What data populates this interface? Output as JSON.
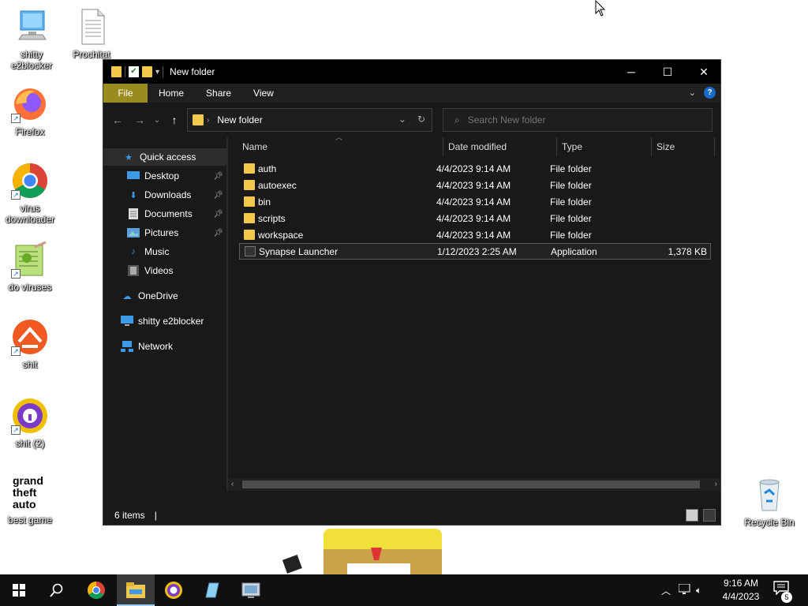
{
  "desktop": {
    "icons": [
      {
        "label": "shitty e2blocker",
        "icon": "computer-icon"
      },
      {
        "label": "Prochitat",
        "icon": "document-icon"
      },
      {
        "label": "Firefox",
        "icon": "firefox-icon"
      },
      {
        "label": "virus downloader",
        "icon": "chrome-icon"
      },
      {
        "label": "do viruses",
        "icon": "notepadpp-icon"
      },
      {
        "label": "shit",
        "icon": "sparkle-icon"
      },
      {
        "label": "shit (2)",
        "icon": "brave-icon"
      },
      {
        "label": "best game",
        "icon": "gta-icon"
      },
      {
        "label": "Recycle Bin",
        "icon": "recycle-bin-icon"
      }
    ]
  },
  "window": {
    "title": "New folder",
    "minimize": "─",
    "maximize": "☐",
    "close": "✕",
    "ribbon_tabs": [
      "File",
      "Home",
      "Share",
      "View"
    ],
    "help": "?",
    "address": "New folder",
    "search_placeholder": "Search New folder",
    "nav": {
      "quick_access": "Quick access",
      "items": [
        {
          "label": "Desktop",
          "pinned": true
        },
        {
          "label": "Downloads",
          "pinned": true
        },
        {
          "label": "Documents",
          "pinned": true
        },
        {
          "label": "Pictures",
          "pinned": true
        },
        {
          "label": "Music",
          "pinned": false
        },
        {
          "label": "Videos",
          "pinned": false
        }
      ],
      "onedrive": "OneDrive",
      "this_pc": "shitty e2blocker",
      "network": "Network"
    },
    "columns": {
      "name": "Name",
      "date": "Date modified",
      "type": "Type",
      "size": "Size"
    },
    "files": [
      {
        "name": "auth",
        "date": "4/4/2023 9:14 AM",
        "type": "File folder",
        "size": "",
        "kind": "folder"
      },
      {
        "name": "autoexec",
        "date": "4/4/2023 9:14 AM",
        "type": "File folder",
        "size": "",
        "kind": "folder"
      },
      {
        "name": "bin",
        "date": "4/4/2023 9:14 AM",
        "type": "File folder",
        "size": "",
        "kind": "folder"
      },
      {
        "name": "scripts",
        "date": "4/4/2023 9:14 AM",
        "type": "File folder",
        "size": "",
        "kind": "folder"
      },
      {
        "name": "workspace",
        "date": "4/4/2023 9:14 AM",
        "type": "File folder",
        "size": "",
        "kind": "folder"
      },
      {
        "name": "Synapse Launcher",
        "date": "1/12/2023 2:25 AM",
        "type": "Application",
        "size": "1,378 KB",
        "kind": "app"
      }
    ],
    "status": "6 items"
  },
  "taskbar": {
    "apps": [
      "start-icon",
      "search-icon",
      "chrome-icon",
      "file-explorer-icon",
      "brave-icon",
      "notepad-icon",
      "control-panel-icon"
    ],
    "active": "file-explorer-icon",
    "time": "9:16 AM",
    "date": "4/4/2023",
    "notifications": "5"
  },
  "colors": {
    "window_bg": "#191919",
    "titlebar": "#000000",
    "file_tab": "#9a8b1f",
    "folder": "#f2c94c",
    "accent": "#1b6ac9"
  }
}
